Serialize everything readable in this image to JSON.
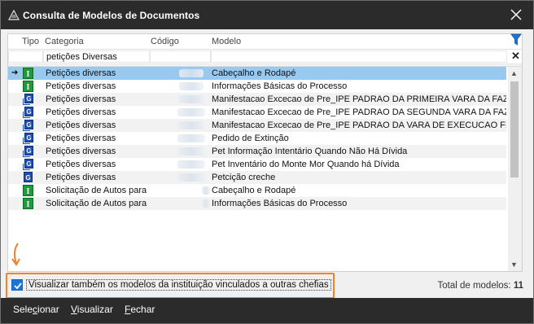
{
  "window": {
    "title": "Consulta de Modelos de Documentos"
  },
  "grid": {
    "columns": [
      "Tipo",
      "Categoria",
      "Código",
      "Modelo"
    ],
    "filter": {
      "categoria": "petições Diversas",
      "codigo": "",
      "modelo": ""
    },
    "rows": [
      {
        "type": "I",
        "categoria": "Petições diversas",
        "modelo": "Cabeçalho e Rodapé",
        "selected": true
      },
      {
        "type": "I",
        "categoria": "Petições diversas",
        "modelo": "Informações Básicas do Processo"
      },
      {
        "type": "G",
        "categoria": "Petições diversas",
        "modelo": "Manifestacao Excecao de Pre_IPE PADRAO DA PRIMEIRA VARA DA FAZEN"
      },
      {
        "type": "G",
        "categoria": "Petições diversas",
        "modelo": "Manifestacao Excecao de Pre_IPE PADRAO DA SEGUNDA VARA DA FAZEN"
      },
      {
        "type": "G",
        "categoria": "Petições diversas",
        "modelo": "Manifestacao Excecao de Pre_IPE PADRAO DA VARA DE EXECUCAO FISCA"
      },
      {
        "type": "G",
        "categoria": "Petições diversas",
        "modelo": "Pedido de Extinção"
      },
      {
        "type": "G",
        "categoria": "Petições diversas",
        "modelo": "Pet Informação Intentário Quando Não Há Dívida"
      },
      {
        "type": "G",
        "categoria": "Petições diversas",
        "modelo": "Pet Inventário do Monte Mor Quando há Dívida"
      },
      {
        "type": "G",
        "categoria": "Petições diversas",
        "modelo": "Petcição creche"
      },
      {
        "type": "I",
        "categoria": "Solicitação de Autos para",
        "modelo": "Cabeçalho e Rodapé"
      },
      {
        "type": "I",
        "categoria": "Solicitação de Autos para",
        "modelo": "Informações Básicas do Processo"
      }
    ]
  },
  "options": {
    "show_linked_models_label": "Visualizar também os modelos da instituição vinculados a outras chefias",
    "show_linked_models_checked": true
  },
  "status": {
    "total_label": "Total de modelos:",
    "total_value": "11"
  },
  "buttons": {
    "select_pre": "Sele",
    "select_key": "c",
    "select_post": "ionar",
    "view_key": "V",
    "view_post": "isualizar",
    "close_key": "F",
    "close_post": "echar"
  },
  "colors": {
    "titlebar": "#2b2b2b",
    "selected_row": "#99c9ef",
    "highlight_box": "#f0822a",
    "checkbox": "#1b74d6",
    "icon_I": "#1e9a3c",
    "icon_G": "#1f4fb3"
  },
  "icons": {
    "app": "document-stack-icon",
    "close": "close-icon",
    "filter": "filter-funnel-icon",
    "clear_filter": "clear-filter-icon",
    "row_pointer": "arrow-right-icon",
    "annotation": "orange-arrow-down-icon"
  }
}
